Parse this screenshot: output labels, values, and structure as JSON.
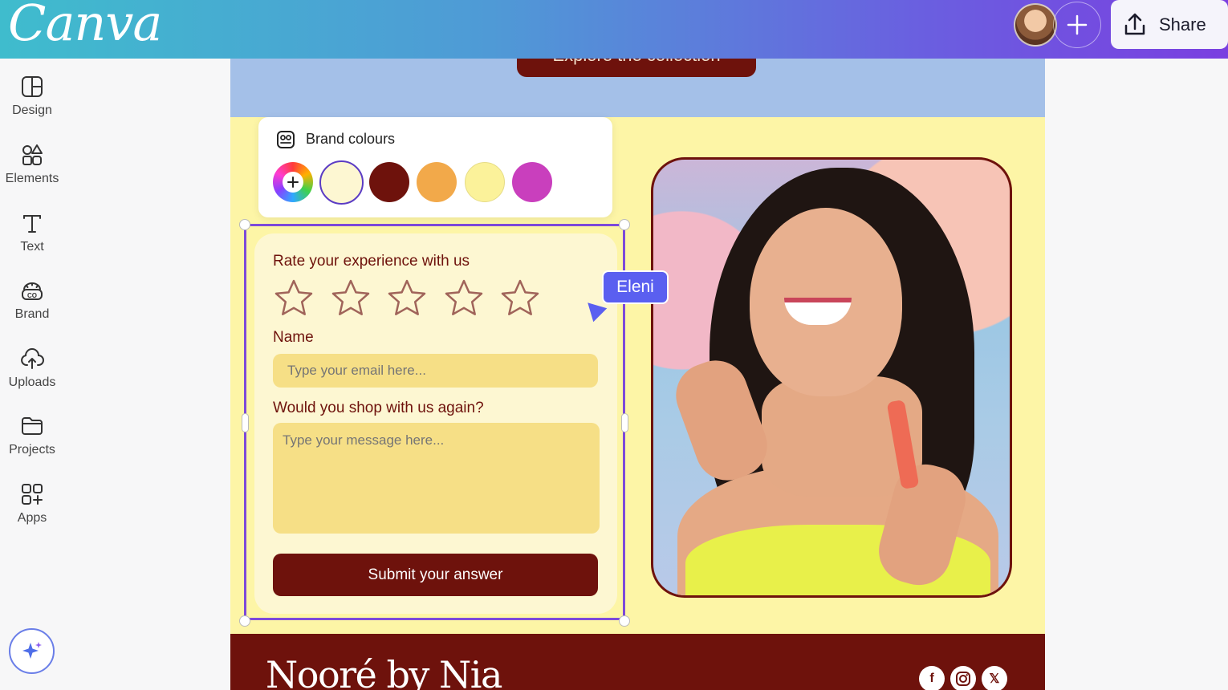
{
  "app": {
    "logo_text": "Canva",
    "share_label": "Share",
    "plus_icon": "plus-icon",
    "share_icon": "share-upload-icon"
  },
  "sidebar": {
    "items": [
      {
        "label": "Design",
        "icon": "design-layout-icon"
      },
      {
        "label": "Elements",
        "icon": "elements-shapes-icon"
      },
      {
        "label": "Text",
        "icon": "text-icon"
      },
      {
        "label": "Brand",
        "icon": "brand-icon"
      },
      {
        "label": "Uploads",
        "icon": "upload-cloud-icon"
      },
      {
        "label": "Projects",
        "icon": "folder-icon"
      },
      {
        "label": "Apps",
        "icon": "apps-grid-icon"
      }
    ],
    "magic_icon": "sparkles-icon"
  },
  "canvas": {
    "explore_button": "Explore the collection",
    "brand_name": "Nooré by Nia",
    "social_icons": [
      "facebook-icon",
      "instagram-icon",
      "x-icon"
    ]
  },
  "brand_colours": {
    "title": "Brand colours",
    "swatches": [
      "#fdf7d2",
      "#6e120c",
      "#f2a94a",
      "#fbf29a",
      "#c93fbd"
    ],
    "selected_index": 0
  },
  "form": {
    "rating_label": "Rate your experience with us",
    "star_count": 5,
    "name_label": "Name",
    "name_placeholder": "Type your email here...",
    "question_label": "Would you shop with us again?",
    "message_placeholder": "Type your message here...",
    "submit_label": "Submit your answer"
  },
  "collaborator": {
    "name": "Eleni",
    "color": "#5a5ff0"
  }
}
